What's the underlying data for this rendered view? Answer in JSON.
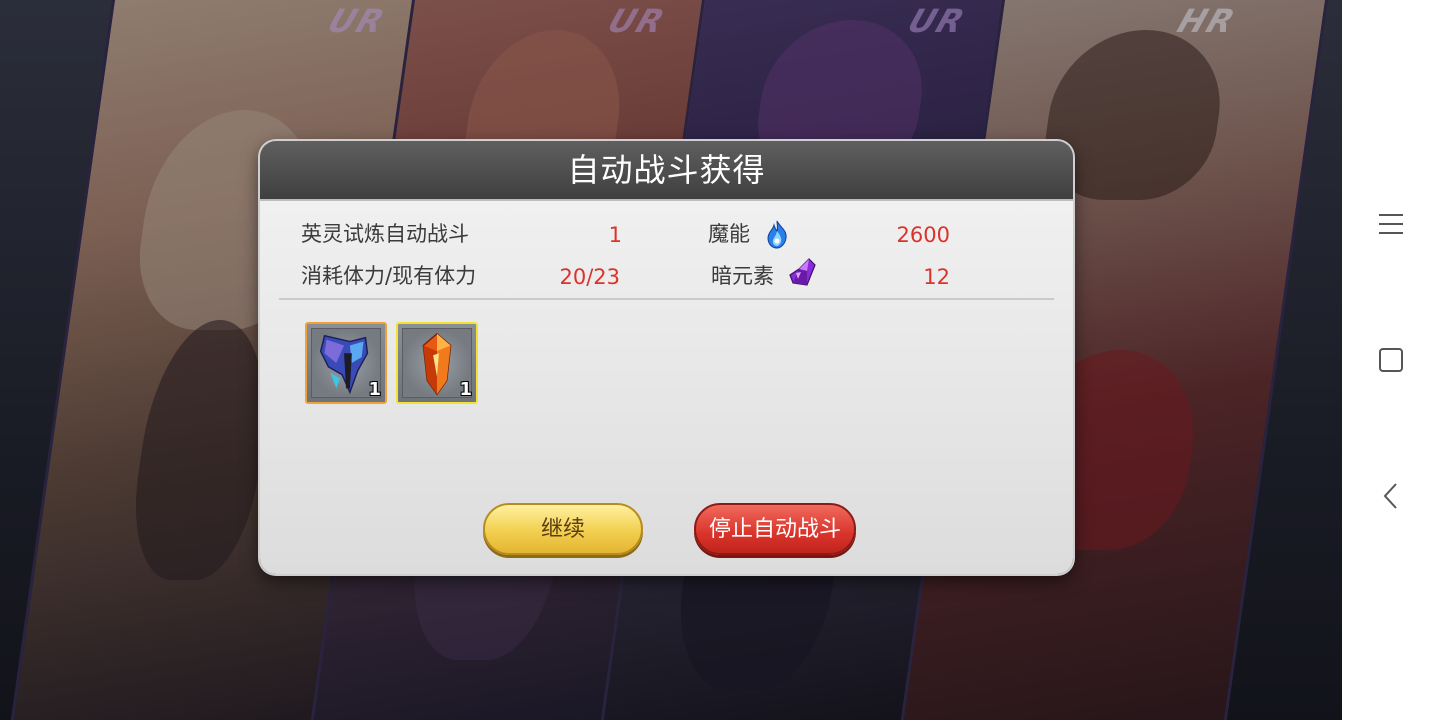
{
  "game": {
    "cards": [
      {
        "rarity": "UR"
      },
      {
        "rarity": "UR"
      },
      {
        "rarity": "UR"
      },
      {
        "rarity": "HR"
      }
    ]
  },
  "dialog": {
    "title": "自动战斗获得",
    "rows": [
      {
        "label": "英灵试炼自动战斗",
        "value": "1"
      },
      {
        "label": "消耗体力/现有体力",
        "value": "20/23"
      }
    ],
    "resources": [
      {
        "label": "魔能",
        "icon": "blue-flame-icon",
        "value": "2600"
      },
      {
        "label": "暗元素",
        "icon": "dark-crystal-icon",
        "value": "12"
      }
    ],
    "items": [
      {
        "icon": "dark-wing-equipment-icon",
        "count": "1",
        "border_color": "#f0a23a"
      },
      {
        "icon": "fire-crystal-icon",
        "count": "1",
        "border_color": "#f2e233"
      }
    ],
    "buttons": {
      "continue_label": "继续",
      "stop_label": "停止自动战斗"
    }
  },
  "nav": {
    "menu_icon": "menu-icon",
    "home_icon": "square-home-icon",
    "back_icon": "back-chevron-icon"
  }
}
